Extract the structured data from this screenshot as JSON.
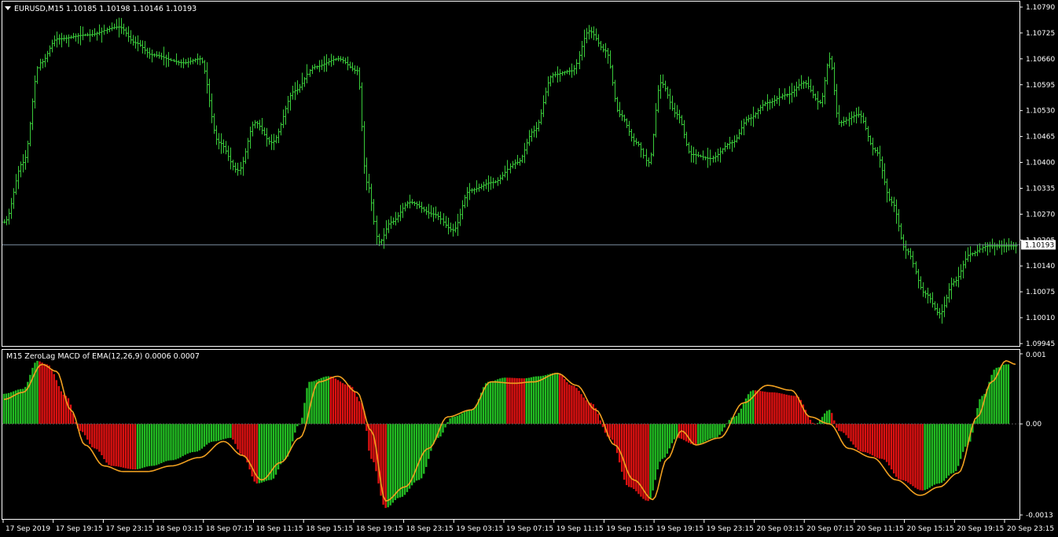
{
  "symbol_header": {
    "symbol": "EURUSD,M15",
    "ohlc": "1.10185 1.10198 1.10146 1.10193"
  },
  "indicator_header": {
    "title": "M15 ZeroLag MACD of EMA(12,26,9) 0.0006 0.0007"
  },
  "colors": {
    "background": "#000000",
    "frame": "#ffffff",
    "price_bars": "#39c93a",
    "hist_up": "#22bb22",
    "hist_down": "#dd1111",
    "signal_line": "#f0a020",
    "bid_line": "#778899"
  },
  "price_axis": {
    "ticks": [
      "1.10790",
      "1.10725",
      "1.10660",
      "1.10595",
      "1.10530",
      "1.10465",
      "1.10400",
      "1.10335",
      "1.10270",
      "1.10205",
      "1.10140",
      "1.10075",
      "1.10010",
      "1.09945"
    ],
    "current_price": "1.10193"
  },
  "indicator_axis": {
    "ticks": [
      "0.001",
      "0.00",
      "-0.0013"
    ]
  },
  "time_axis": {
    "ticks": [
      "17 Sep 2019",
      "17 Sep 19:15",
      "17 Sep 23:15",
      "18 Sep 03:15",
      "18 Sep 07:15",
      "18 Sep 11:15",
      "18 Sep 15:15",
      "18 Sep 19:15",
      "18 Sep 23:15",
      "19 Sep 03:15",
      "19 Sep 07:15",
      "19 Sep 11:15",
      "19 Sep 15:15",
      "19 Sep 19:15",
      "19 Sep 23:15",
      "20 Sep 03:15",
      "20 Sep 07:15",
      "20 Sep 11:15",
      "20 Sep 15:15",
      "20 Sep 19:15",
      "20 Sep 23:15"
    ]
  },
  "chart_data": [
    {
      "type": "line",
      "subtype": "ohlc-bars",
      "name": "EURUSD,M15",
      "timeframe": "M15",
      "ylim": [
        1.09945,
        1.1079
      ],
      "current_price": 1.10193,
      "close_anchors": [
        [
          0,
          1.1025
        ],
        [
          8,
          1.104
        ],
        [
          15,
          1.1065
        ],
        [
          22,
          1.1071
        ],
        [
          35,
          1.1072
        ],
        [
          48,
          1.1074
        ],
        [
          55,
          1.107
        ],
        [
          62,
          1.1067
        ],
        [
          75,
          1.1065
        ],
        [
          82,
          1.1066
        ],
        [
          90,
          1.1045
        ],
        [
          98,
          1.1038
        ],
        [
          105,
          1.105
        ],
        [
          112,
          1.1045
        ],
        [
          122,
          1.1058
        ],
        [
          130,
          1.1064
        ],
        [
          140,
          1.1066
        ],
        [
          148,
          1.1063
        ],
        [
          152,
          1.1035
        ],
        [
          157,
          1.102
        ],
        [
          162,
          1.1025
        ],
        [
          170,
          1.103
        ],
        [
          180,
          1.1027
        ],
        [
          188,
          1.1023
        ],
        [
          195,
          1.1033
        ],
        [
          205,
          1.1035
        ],
        [
          215,
          1.104
        ],
        [
          222,
          1.1048
        ],
        [
          230,
          1.1062
        ],
        [
          238,
          1.1063
        ],
        [
          245,
          1.1073
        ],
        [
          252,
          1.1068
        ],
        [
          258,
          1.1052
        ],
        [
          265,
          1.1045
        ],
        [
          270,
          1.104
        ],
        [
          275,
          1.106
        ],
        [
          282,
          1.1052
        ],
        [
          288,
          1.1042
        ],
        [
          296,
          1.1041
        ],
        [
          305,
          1.1045
        ],
        [
          312,
          1.1051
        ],
        [
          320,
          1.1055
        ],
        [
          328,
          1.1057
        ],
        [
          335,
          1.106
        ],
        [
          342,
          1.1055
        ],
        [
          346,
          1.1066
        ],
        [
          350,
          1.105
        ],
        [
          358,
          1.1052
        ],
        [
          365,
          1.1043
        ],
        [
          372,
          1.103
        ],
        [
          378,
          1.1018
        ],
        [
          386,
          1.1007
        ],
        [
          392,
          1.1002
        ],
        [
          398,
          1.101
        ],
        [
          405,
          1.1017
        ],
        [
          412,
          1.1019
        ],
        [
          418,
          1.1019
        ]
      ]
    },
    {
      "type": "bar",
      "subtype": "macd-histogram-with-signal",
      "name": "M15 ZeroLag MACD of EMA(12,26,9)",
      "ylim": [
        -0.0013,
        0.001
      ],
      "macd": 0.0006,
      "signal": 0.0007,
      "macd_anchors": [
        [
          0,
          0.00043
        ],
        [
          8,
          0.0005
        ],
        [
          14,
          0.0009
        ],
        [
          18,
          0.00085
        ],
        [
          26,
          0.0004
        ],
        [
          32,
          -0.0001
        ],
        [
          38,
          -0.00035
        ],
        [
          45,
          -0.0006
        ],
        [
          55,
          -0.00065
        ],
        [
          62,
          -0.0006
        ],
        [
          70,
          -0.00052
        ],
        [
          80,
          -0.0004
        ],
        [
          88,
          -0.00025
        ],
        [
          95,
          -0.0002
        ],
        [
          100,
          -0.00045
        ],
        [
          106,
          -0.00085
        ],
        [
          112,
          -0.0008
        ],
        [
          118,
          -0.0005
        ],
        [
          124,
          0.0
        ],
        [
          128,
          0.0006
        ],
        [
          136,
          0.00068
        ],
        [
          145,
          0.00055
        ],
        [
          150,
          0.0003
        ],
        [
          154,
          -0.0005
        ],
        [
          160,
          -0.0012
        ],
        [
          166,
          -0.00105
        ],
        [
          174,
          -0.0008
        ],
        [
          182,
          -0.0002
        ],
        [
          188,
          0.0001
        ],
        [
          196,
          0.0002
        ],
        [
          203,
          0.0006
        ],
        [
          210,
          0.00066
        ],
        [
          218,
          0.00065
        ],
        [
          224,
          0.00068
        ],
        [
          232,
          0.00073
        ],
        [
          238,
          0.00055
        ],
        [
          246,
          0.0003
        ],
        [
          254,
          -0.0002
        ],
        [
          262,
          -0.0009
        ],
        [
          270,
          -0.0011
        ],
        [
          276,
          -0.0005
        ],
        [
          282,
          -0.0002
        ],
        [
          290,
          -0.0003
        ],
        [
          298,
          -0.0002
        ],
        [
          306,
          0.0001
        ],
        [
          314,
          0.00048
        ],
        [
          322,
          0.00045
        ],
        [
          332,
          0.0004
        ],
        [
          340,
          0.0
        ],
        [
          346,
          0.0002
        ],
        [
          350,
          -0.0001
        ],
        [
          360,
          -0.0004
        ],
        [
          368,
          -0.0005
        ],
        [
          376,
          -0.0008
        ],
        [
          385,
          -0.00095
        ],
        [
          392,
          -0.00085
        ],
        [
          398,
          -0.0007
        ],
        [
          404,
          -0.0003
        ],
        [
          410,
          0.0004
        ],
        [
          416,
          0.0008
        ],
        [
          420,
          0.00085
        ]
      ],
      "signal_anchors": [
        [
          0,
          0.00035
        ],
        [
          8,
          0.00045
        ],
        [
          16,
          0.00085
        ],
        [
          22,
          0.00075
        ],
        [
          28,
          0.0002
        ],
        [
          34,
          -0.0003
        ],
        [
          42,
          -0.0006
        ],
        [
          50,
          -0.00068
        ],
        [
          60,
          -0.00068
        ],
        [
          70,
          -0.0006
        ],
        [
          82,
          -0.00048
        ],
        [
          92,
          -0.00025
        ],
        [
          100,
          -0.00045
        ],
        [
          108,
          -0.0008
        ],
        [
          116,
          -0.00055
        ],
        [
          124,
          -0.0002
        ],
        [
          132,
          0.0006
        ],
        [
          140,
          0.00068
        ],
        [
          148,
          0.00045
        ],
        [
          154,
          -0.0001
        ],
        [
          160,
          -0.0011
        ],
        [
          168,
          -0.0009
        ],
        [
          178,
          -0.00035
        ],
        [
          186,
          0.0001
        ],
        [
          196,
          0.0002
        ],
        [
          204,
          0.0006
        ],
        [
          214,
          0.00058
        ],
        [
          222,
          0.0006
        ],
        [
          232,
          0.00072
        ],
        [
          240,
          0.00055
        ],
        [
          248,
          0.0002
        ],
        [
          256,
          -0.0003
        ],
        [
          264,
          -0.0008
        ],
        [
          272,
          -0.00108
        ],
        [
          278,
          -0.0005
        ],
        [
          284,
          -0.0001
        ],
        [
          290,
          -0.0003
        ],
        [
          300,
          -0.0002
        ],
        [
          310,
          0.0003
        ],
        [
          320,
          0.00055
        ],
        [
          330,
          0.00048
        ],
        [
          338,
          0.0001
        ],
        [
          346,
          0.0
        ],
        [
          354,
          -0.00035
        ],
        [
          364,
          -0.00048
        ],
        [
          374,
          -0.0008
        ],
        [
          384,
          -0.00102
        ],
        [
          392,
          -0.0009
        ],
        [
          400,
          -0.0007
        ],
        [
          408,
          0.0001
        ],
        [
          414,
          0.0006
        ],
        [
          420,
          0.0009
        ],
        [
          424,
          0.00085
        ]
      ]
    }
  ]
}
